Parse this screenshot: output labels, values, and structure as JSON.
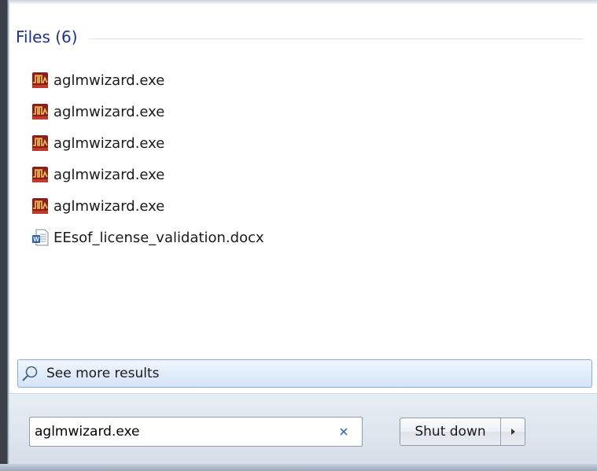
{
  "results": {
    "group_title": "Files (6)",
    "files": [
      {
        "name": "aglmwizard.exe",
        "icon": "agilent-wizard-icon"
      },
      {
        "name": "aglmwizard.exe",
        "icon": "agilent-wizard-icon"
      },
      {
        "name": "aglmwizard.exe",
        "icon": "agilent-wizard-icon"
      },
      {
        "name": "aglmwizard.exe",
        "icon": "agilent-wizard-icon"
      },
      {
        "name": "aglmwizard.exe",
        "icon": "agilent-wizard-icon"
      },
      {
        "name": "EEsof_license_validation.docx",
        "icon": "word-document-icon"
      }
    ],
    "see_more_label": "See more results"
  },
  "search": {
    "value": "aglmwizard.exe",
    "clear_icon": "close-icon"
  },
  "power": {
    "shutdown_label": "Shut down",
    "arrow_icon": "chevron-right-icon"
  },
  "colors": {
    "group_title": "#1e3287",
    "see_more_border": "#84acdd",
    "exe_icon_bg": "#8a1e1e",
    "exe_icon_wave": "#f0c24a"
  }
}
